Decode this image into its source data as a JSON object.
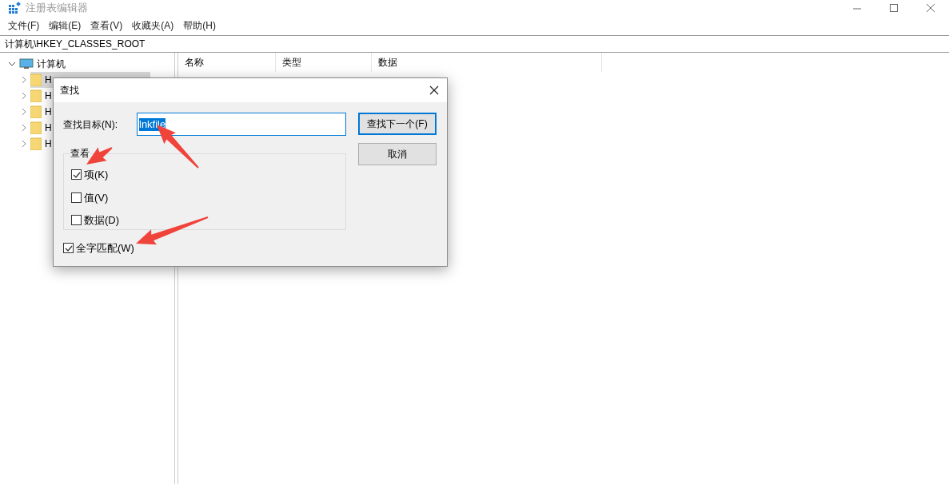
{
  "window": {
    "title": "注册表编辑器"
  },
  "menu": [
    "文件(F)",
    "编辑(E)",
    "查看(V)",
    "收藏夹(A)",
    "帮助(H)"
  ],
  "address": "计算机\\HKEY_CLASSES_ROOT",
  "tree": {
    "label": "计算机",
    "expanded": true,
    "children": [
      {
        "label": "H",
        "selected": true
      },
      {
        "label": "H",
        "selected": false
      },
      {
        "label": "H",
        "selected": false
      },
      {
        "label": "H",
        "selected": false
      },
      {
        "label": "H",
        "selected": false
      }
    ]
  },
  "columns": [
    "名称",
    "类型",
    "数据"
  ],
  "dialog": {
    "title": "查找",
    "find_label": "查找目标(N):",
    "find_value": "lnkfile",
    "group_title": "查看",
    "options": [
      {
        "label": "项(K)",
        "checked": true
      },
      {
        "label": "值(V)",
        "checked": false
      },
      {
        "label": "数据(D)",
        "checked": false
      }
    ],
    "whole_word": {
      "label": "全字匹配(W)",
      "checked": true
    },
    "buttons": [
      {
        "label": "查找下一个(F)",
        "default": true
      },
      {
        "label": "取消",
        "default": false
      }
    ]
  }
}
